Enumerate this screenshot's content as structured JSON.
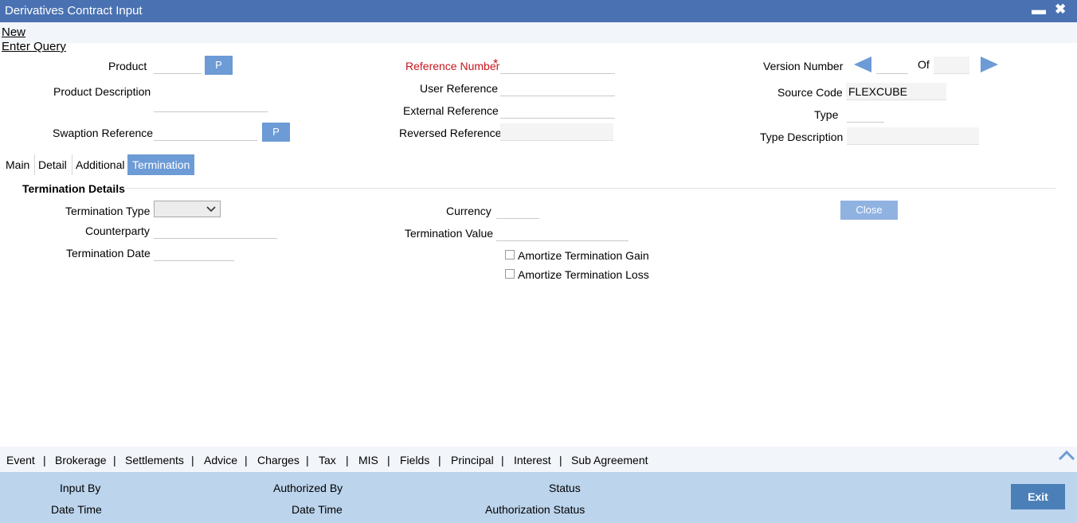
{
  "window": {
    "title": "Derivatives Contract Input",
    "minimize_glyph": "▬",
    "close_glyph": "✖"
  },
  "menu": {
    "new": "New",
    "enter_query": "Enter Query"
  },
  "header": {
    "product_label": "Product",
    "product_description_label": "Product Description",
    "swaption_reference_label": "Swaption Reference",
    "p_label": "P",
    "reference_number_label": "Reference Number",
    "required_marker": "*",
    "user_reference_label": "User Reference",
    "external_reference_label": "External Reference",
    "reversed_reference_label": "Reversed Reference",
    "version_number_label": "Version Number",
    "of_label": "Of",
    "source_code_label": "Source Code",
    "source_code_value": "FLEXCUBE",
    "type_label": "Type",
    "type_description_label": "Type Description"
  },
  "tabs": [
    "Main",
    "Detail",
    "Additional",
    "Termination Details"
  ],
  "termination": {
    "section_title": "Termination Details",
    "termination_type_label": "Termination Type",
    "counterparty_label": "Counterparty",
    "termination_date_label": "Termination Date",
    "currency_label": "Currency",
    "termination_value_label": "Termination Value",
    "amortize_gain_label": "Amortize Termination Gain",
    "amortize_loss_label": "Amortize Termination Loss",
    "close_label": "Close"
  },
  "bottom_links": [
    "Event",
    "Brokerage",
    "Settlements",
    "Advice",
    "Charges",
    "Tax",
    "MIS",
    "Fields",
    "Principal",
    "Interest",
    "Sub Agreement"
  ],
  "footer": {
    "input_by": "Input By",
    "date_time": "Date Time",
    "authorized_by": "Authorized By",
    "status": "Status",
    "authorization_status": "Authorization Status",
    "exit": "Exit"
  },
  "colors": {
    "titlebar": "#4a72b2",
    "accent": "#6c9bd6",
    "required": "#c4161c",
    "footer": "#bcd4ec",
    "exit": "#4b7fb8"
  }
}
